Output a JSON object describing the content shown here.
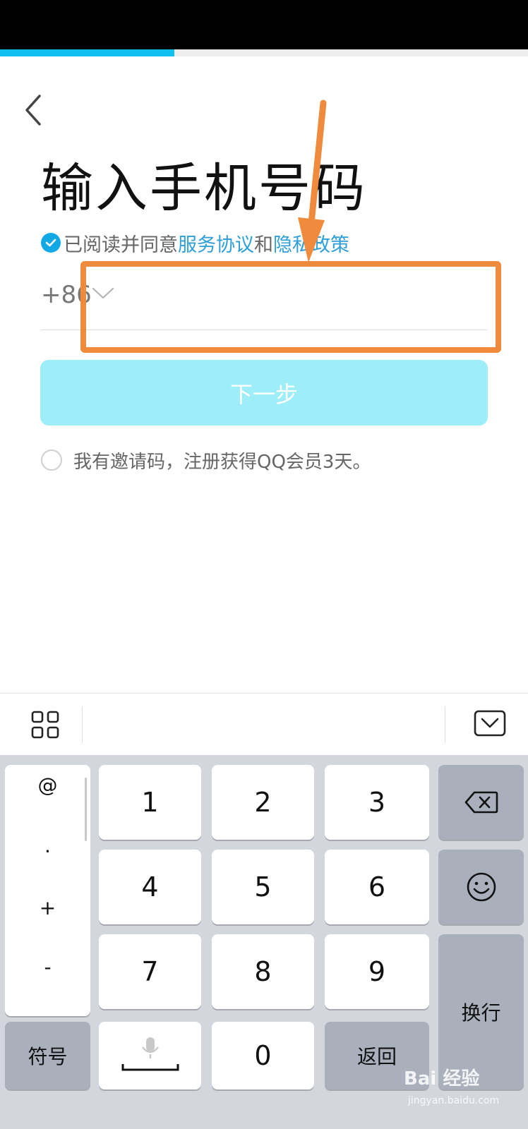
{
  "progress": {
    "fraction": 0.33
  },
  "title": "输入手机号码",
  "agreement": {
    "prefix": "已阅读并同意",
    "service_link": "服务协议",
    "connector": "和",
    "privacy_link": "隐私政策",
    "checked": true
  },
  "phone": {
    "country_code": "+86",
    "value": "",
    "placeholder": ""
  },
  "next_button": "下一步",
  "invite": "我有邀请码，注册获得QQ会员3天。",
  "keyboard": {
    "symbols": [
      "@",
      ".",
      "+",
      "-"
    ],
    "digits": [
      "1",
      "2",
      "3",
      "4",
      "5",
      "6",
      "7",
      "8",
      "9"
    ],
    "zero": "0",
    "symbols_key": "符号",
    "back_key": "返回",
    "enter_key": "换行"
  },
  "watermark": {
    "text": "Bai 经验",
    "sub": "jingyan.baidu.com"
  },
  "colors": {
    "accent": "#12a8e6",
    "link": "#2e9fd8",
    "button_disabled": "#9deef8",
    "annotation": "#f08b3e"
  }
}
